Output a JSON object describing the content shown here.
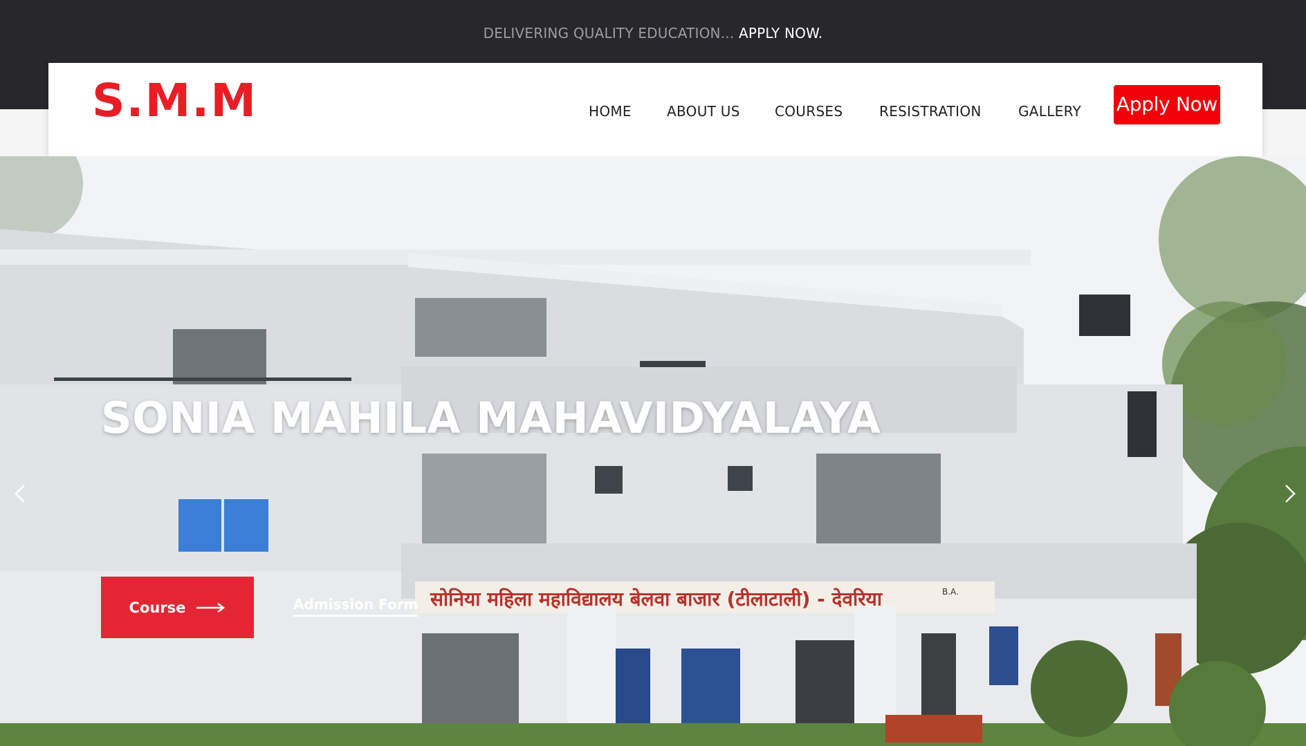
{
  "topbar": {
    "tagline": "DELIVERING QUALITY EDUCATION...",
    "cta": "APPLY NOW."
  },
  "header": {
    "logo": "S.M.M",
    "nav": [
      "HOME",
      "ABOUT US",
      "COURSES",
      "RESISTRATION",
      "GALLERY"
    ],
    "apply_button": "Apply Now"
  },
  "hero": {
    "title": "SONIA MAHILA MAHAVIDYALAYA",
    "course_button": "Course",
    "admission_link": "Admission Form",
    "signboard": "सोनिया महिला महाविद्यालय बेलवा बाजार (टीलाटाली) - देवरिया",
    "signboard_badge": "B.A."
  },
  "colors": {
    "topbar_bg": "#28282c",
    "brand_red": "#ea1c24",
    "apply_red": "#f20009",
    "course_red": "#e42634"
  },
  "icons": {
    "prev": "chevron-left-icon",
    "next": "chevron-right-icon",
    "course_arrow": "long-arrow-right-icon"
  }
}
